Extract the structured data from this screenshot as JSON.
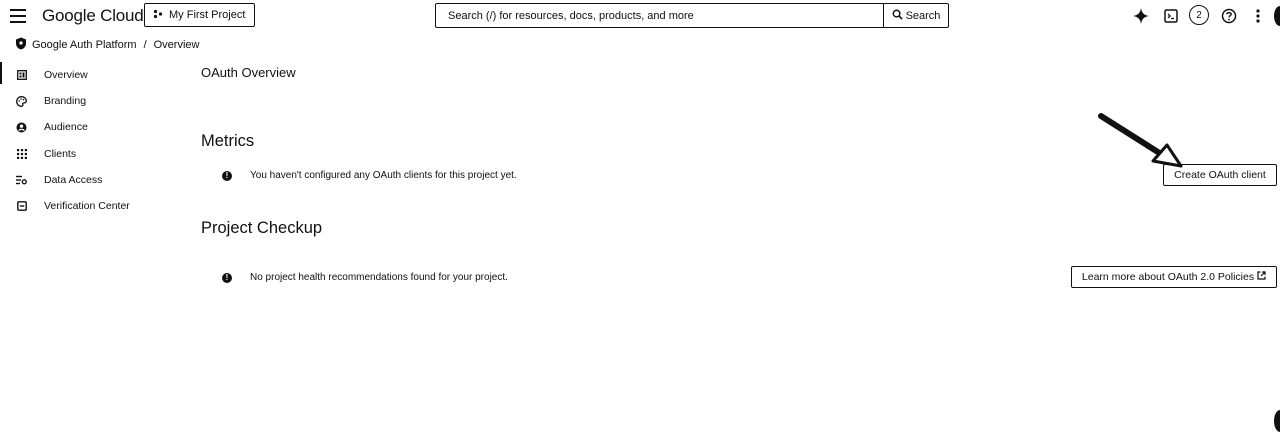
{
  "header": {
    "brand": "Google Cloud",
    "project_label": "My First Project",
    "search": {
      "placeholder": "Search (/) for resources, docs, products, and more",
      "button_label": "Search"
    },
    "notification_count": "2"
  },
  "breadcrumb": {
    "items": [
      "Google Auth Platform",
      "Overview"
    ],
    "separator": "/"
  },
  "sidebar": {
    "items": [
      {
        "label": "Overview",
        "icon": "dashboard-icon",
        "active": true
      },
      {
        "label": "Branding",
        "icon": "palette-icon"
      },
      {
        "label": "Audience",
        "icon": "person-icon"
      },
      {
        "label": "Clients",
        "icon": "grid-icon"
      },
      {
        "label": "Data Access",
        "icon": "settings-list-icon"
      },
      {
        "label": "Verification Center",
        "icon": "verified-icon"
      }
    ]
  },
  "main": {
    "title": "OAuth Overview",
    "metrics": {
      "heading": "Metrics",
      "message": "You haven't configured any OAuth clients for this project yet.",
      "button_label": "Create OAuth client"
    },
    "checkup": {
      "heading": "Project Checkup",
      "message": "No project health recommendations found for your project.",
      "button_label": "Learn more about OAuth 2.0 Policies"
    }
  },
  "colors": {
    "foreground": "#111111",
    "background": "#ffffff"
  }
}
